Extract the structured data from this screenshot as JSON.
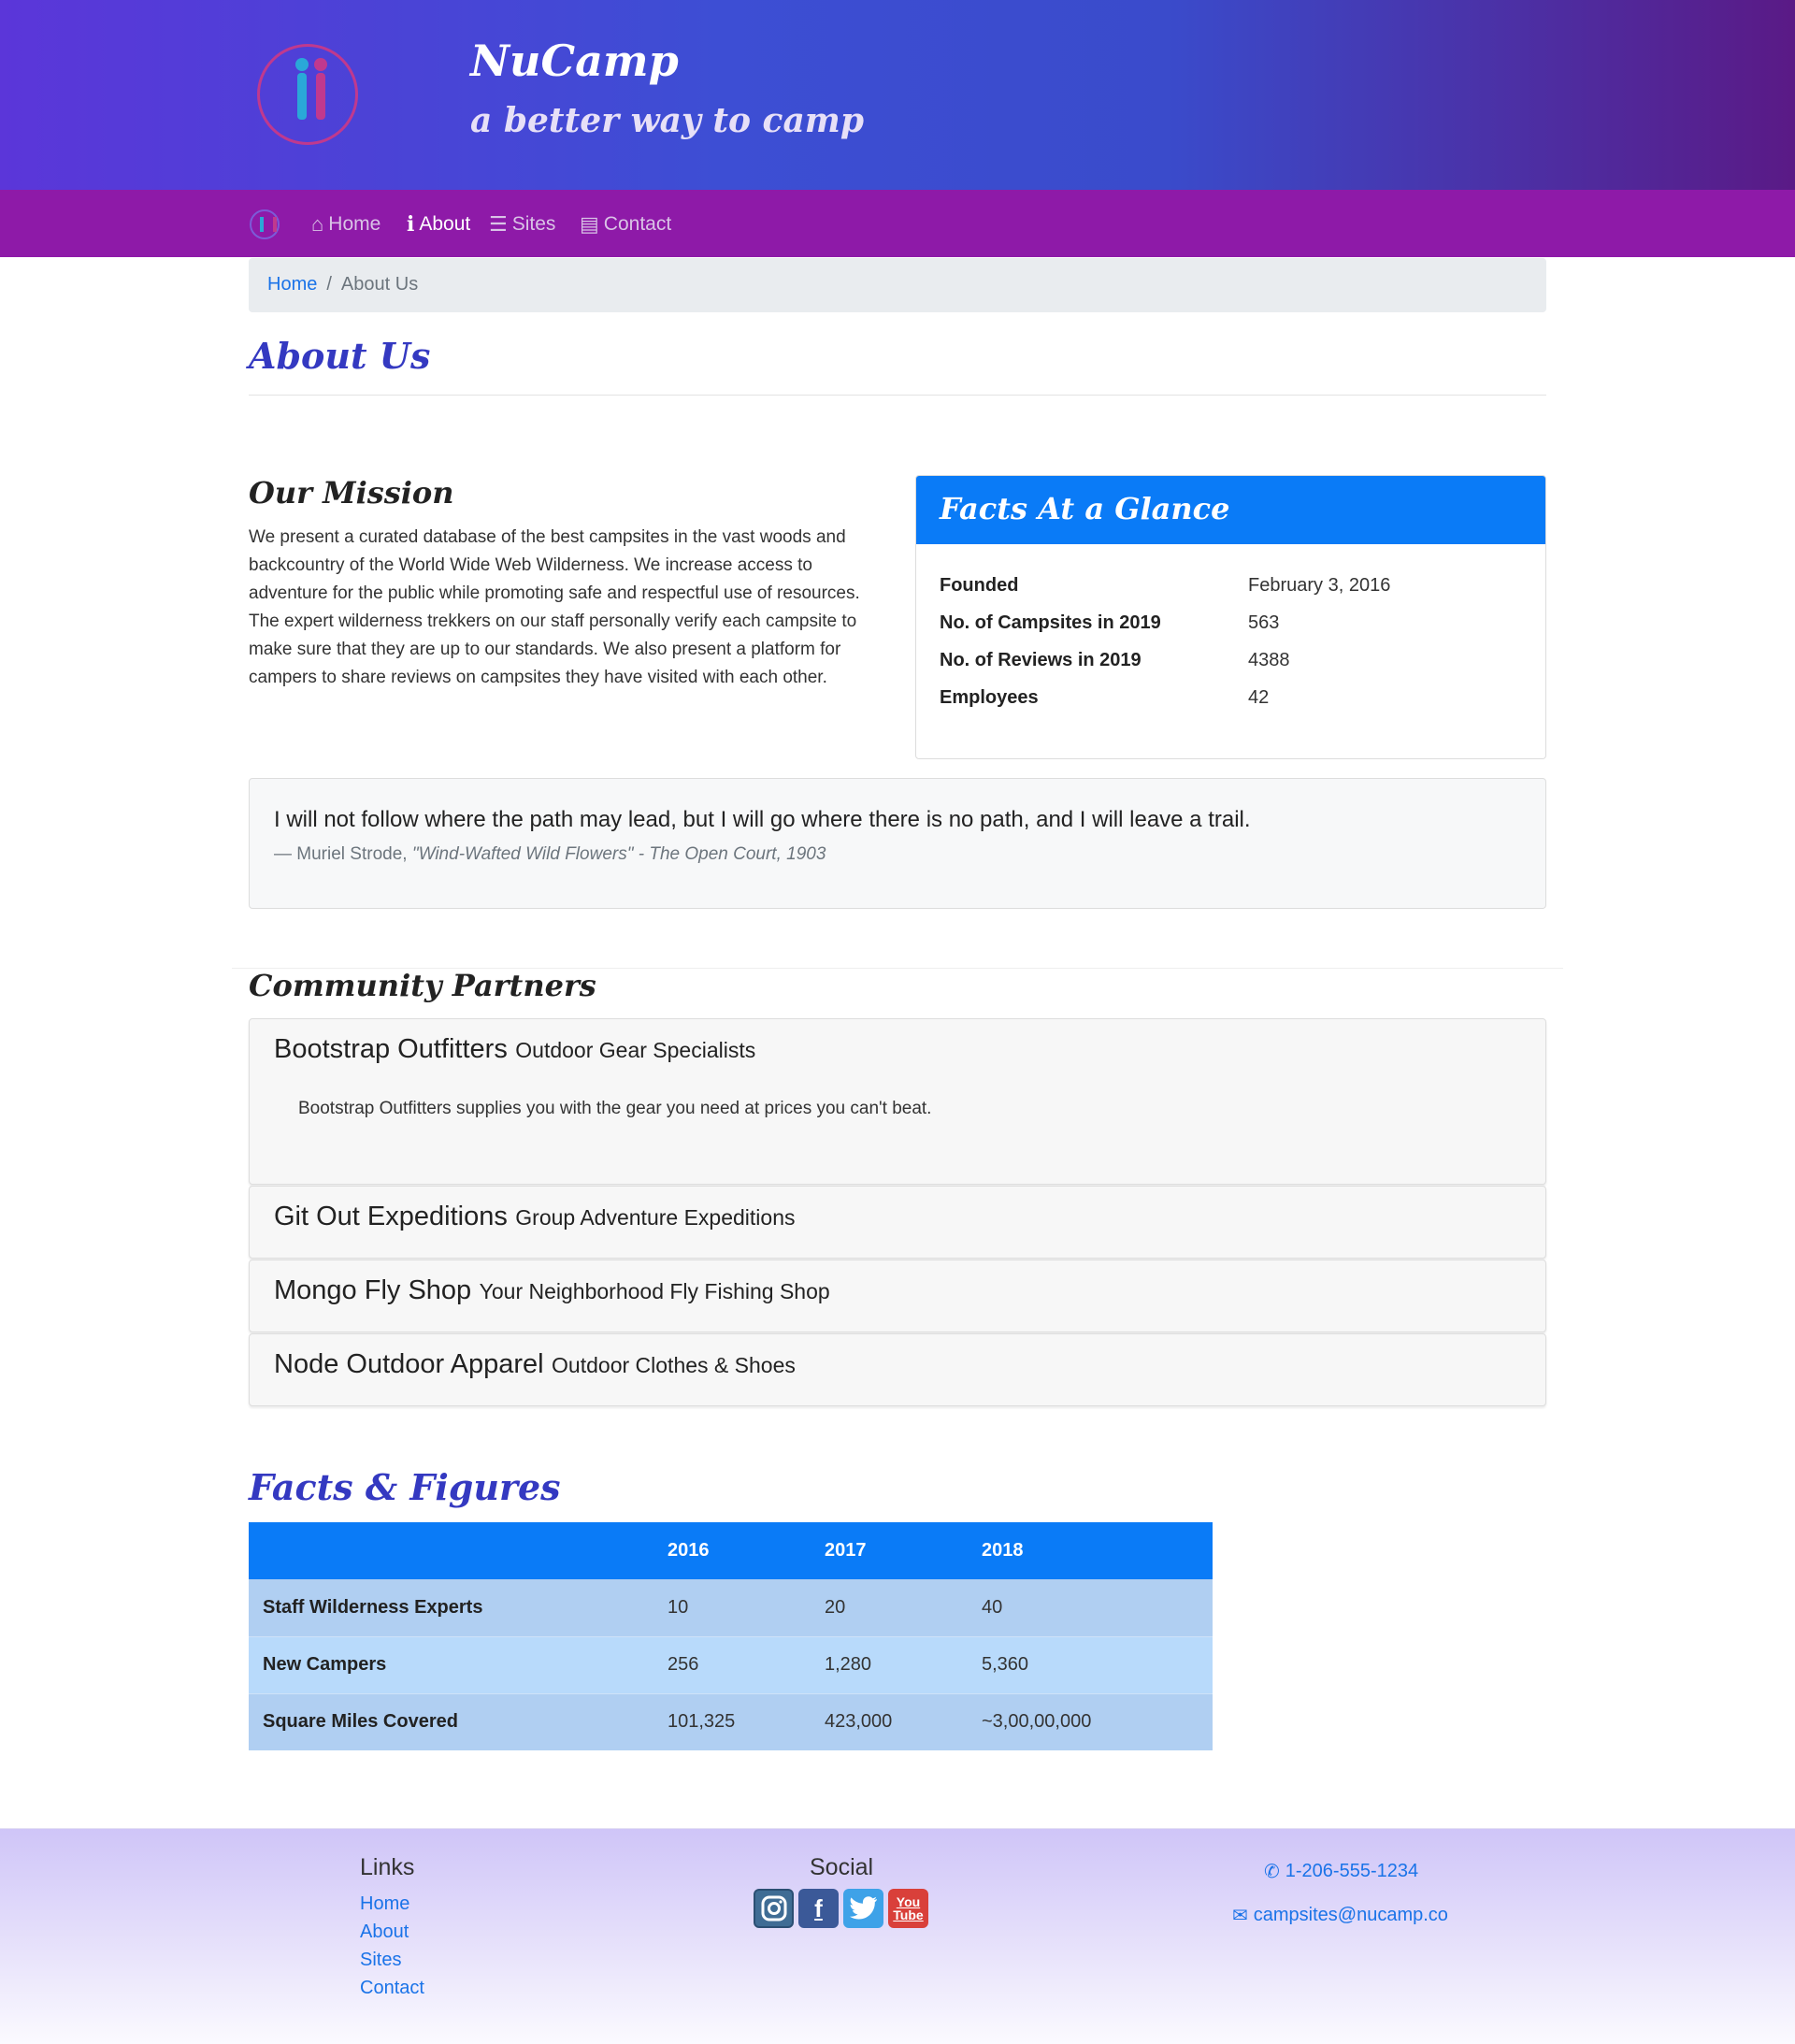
{
  "header": {
    "brand": "NuCamp",
    "tagline": "a better way to camp"
  },
  "nav": {
    "items": [
      {
        "label": "Home",
        "icon": "home-icon"
      },
      {
        "label": "About",
        "icon": "info-icon"
      },
      {
        "label": "Sites",
        "icon": "list-icon"
      },
      {
        "label": "Contact",
        "icon": "address-card-icon"
      }
    ]
  },
  "breadcrumb": {
    "home": "Home",
    "separator": "/",
    "current": "About Us"
  },
  "page_title": "About Us",
  "mission": {
    "title": "Our Mission",
    "text": "We present a curated database of the best campsites in the vast woods and backcountry of the World Wide Web Wilderness. We increase access to adventure for the public while promoting safe and respectful use of resources. The expert wilderness trekkers on our staff personally verify each campsite to make sure that they are up to our standards. We also present a platform for campers to share reviews on campsites they have visited with each other."
  },
  "facts": {
    "title": "Facts At a Glance",
    "rows": [
      {
        "label": "Founded",
        "value": "February 3, 2016"
      },
      {
        "label": "No. of Campsites in 2019",
        "value": "563"
      },
      {
        "label": "No. of Reviews in 2019",
        "value": "4388"
      },
      {
        "label": "Employees",
        "value": "42"
      }
    ]
  },
  "quote": {
    "text": "I will not follow where the path may lead, but I will go where there is no path, and I will leave a trail.",
    "author": "— Muriel Strode, ",
    "source": "\"Wind-Wafted Wild Flowers\" - The Open Court, 1903"
  },
  "partners": {
    "title": "Community Partners",
    "items": [
      {
        "name": "Bootstrap Outfitters",
        "tag": "Outdoor Gear Specialists",
        "desc": "Bootstrap Outfitters supplies you with the gear you need at prices you can't beat."
      },
      {
        "name": "Git Out Expeditions",
        "tag": "Group Adventure Expeditions"
      },
      {
        "name": "Mongo Fly Shop",
        "tag": "Your Neighborhood Fly Fishing Shop"
      },
      {
        "name": "Node Outdoor Apparel",
        "tag": "Outdoor Clothes & Shoes"
      }
    ]
  },
  "figures": {
    "title": "Facts & Figures",
    "headers": [
      "",
      "2016",
      "2017",
      "2018"
    ],
    "rows": [
      [
        "Staff Wilderness Experts",
        "10",
        "20",
        "40"
      ],
      [
        "New Campers",
        "256",
        "1,280",
        "5,360"
      ],
      [
        "Square Miles Covered",
        "101,325",
        "423,000",
        "~3,00,00,000"
      ]
    ]
  },
  "footer": {
    "links_title": "Links",
    "links": [
      "Home",
      "About",
      "Sites",
      "Contact"
    ],
    "social_title": "Social",
    "social": [
      "instagram-icon",
      "facebook-icon",
      "twitter-icon",
      "youtube-icon"
    ],
    "youtube_label": "You Tube",
    "phone": "1-206-555-1234",
    "email": "campsites@nucamp.co"
  },
  "colors": {
    "brand_purple": "#8e1aa8",
    "primary_blue": "#0a7bf7",
    "heading_blue": "#3439c1",
    "link_blue": "#1a73e8"
  }
}
